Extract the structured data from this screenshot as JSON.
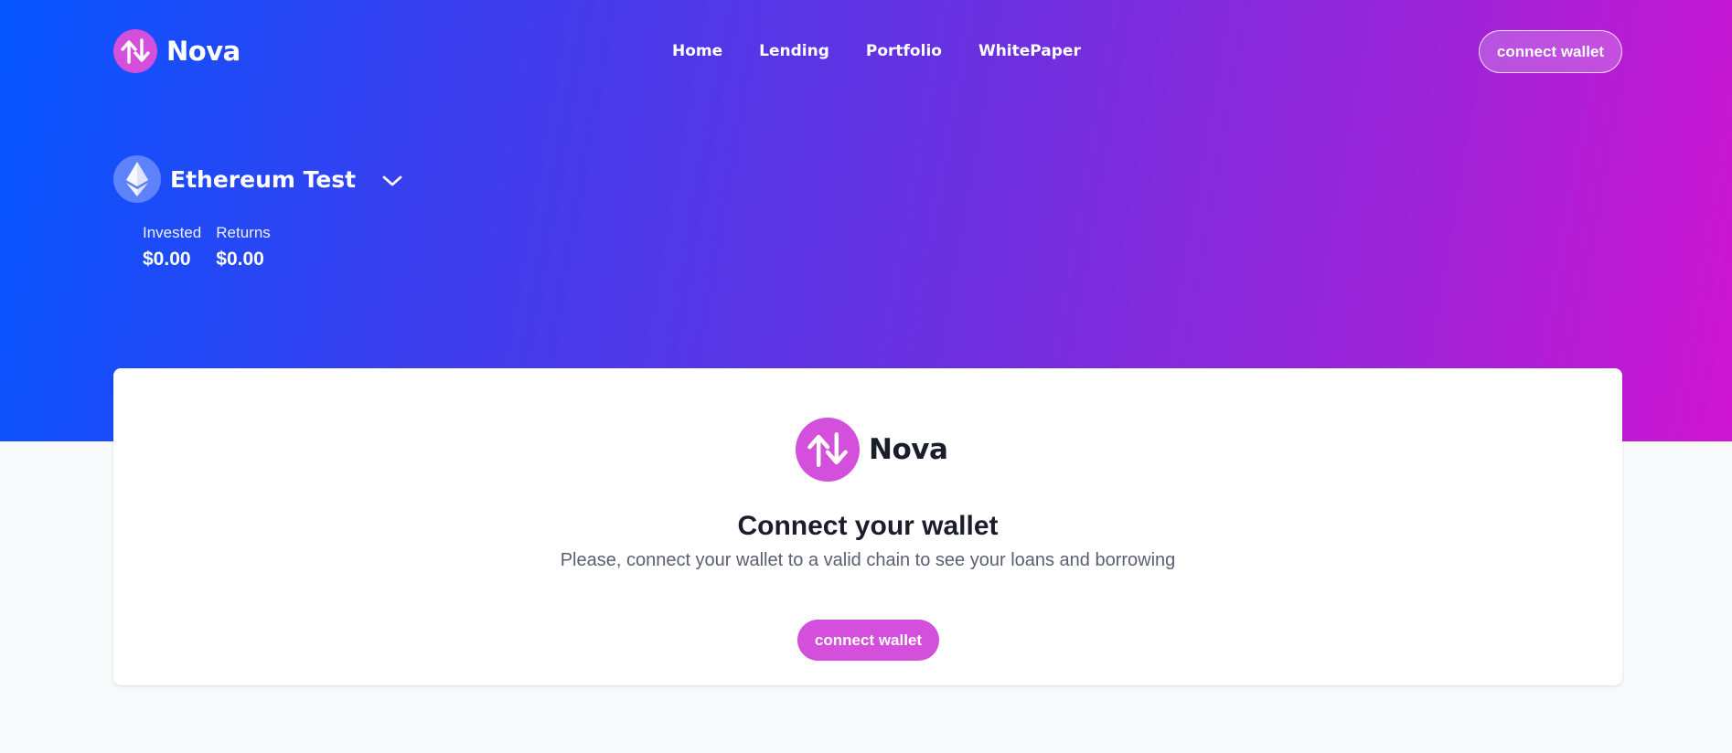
{
  "brand": {
    "name": "Nova",
    "logo_icon": "up-down-arrows-icon",
    "logo_color": "#d44fdc"
  },
  "nav": {
    "links": [
      "Home",
      "Lending",
      "Portfolio",
      "WhitePaper"
    ],
    "connect_label": "connect wallet"
  },
  "chain": {
    "name": "Ethereum Test",
    "icon": "ethereum-icon"
  },
  "stats": {
    "invested_label": "Invested",
    "invested_value": "$0.00",
    "returns_label": "Returns",
    "returns_value": "$0.00"
  },
  "card": {
    "brand_name": "Nova",
    "title": "Connect your wallet",
    "subtitle": "Please, connect your wallet to a valid chain to see your loans and borrowing",
    "button_label": "connect wallet"
  },
  "colors": {
    "gradient_start": "#0456ff",
    "gradient_end": "#cf15d2",
    "accent": "#d44fdc",
    "page_bg": "#f8f9fb"
  }
}
